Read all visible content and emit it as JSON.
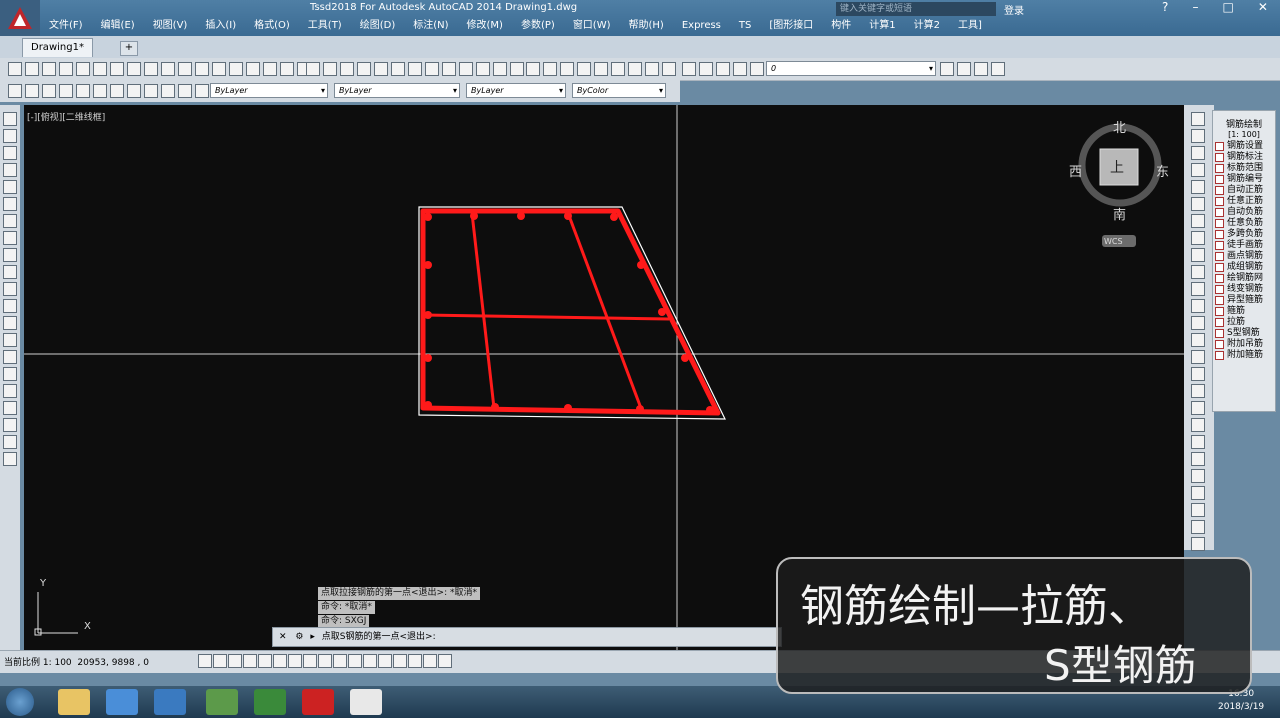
{
  "window": {
    "title": "Tssd2018 For Autodesk AutoCAD 2014    Drawing1.dwg",
    "search_placeholder": "键入关键字或短语",
    "login_label": "登录",
    "controls": [
      "–",
      "□",
      "✕"
    ]
  },
  "menu": [
    "文件(F)",
    "编辑(E)",
    "视图(V)",
    "插入(I)",
    "格式(O)",
    "工具(T)",
    "绘图(D)",
    "标注(N)",
    "修改(M)",
    "参数(P)",
    "窗口(W)",
    "帮助(H)",
    "Express",
    "TS",
    "[图形接口",
    "构件",
    "计算1",
    "计算2",
    "工具]"
  ],
  "tabs": {
    "active": "Drawing1*",
    "add": "+"
  },
  "toolbar": {
    "layer_value": "0",
    "color_dropdown": "ByLayer",
    "linetype_dropdown": "ByLayer",
    "lineweight_dropdown": "ByLayer",
    "plotstyle_dropdown": "ByColor"
  },
  "viewport": {
    "label": "[-][俯视][二维线框]",
    "compass": {
      "north": "北",
      "south": "南",
      "east": "东",
      "west": "西",
      "center": "上",
      "wcs": "WCS"
    },
    "ucs": {
      "x": "X",
      "y": "Y"
    }
  },
  "rebar_panel": {
    "title": "钢筋绘制",
    "subtitle": "[1: 100]",
    "items": [
      "钢筋设置",
      "钢筋标注",
      "标筋范围",
      "钢筋编号",
      "自动正筋",
      "任意正筋",
      "自动负筋",
      "任意负筋",
      "多跨负筋",
      "徒手画筋",
      "画点钢筋",
      "成组钢筋",
      "绘钢筋网",
      "线变钢筋",
      "异型箍筋",
      "箍筋",
      "拉筋",
      "S型钢筋",
      "附加吊筋",
      "附加箍筋"
    ]
  },
  "command": {
    "history": [
      "点取拉接钢筋的第一点<退出>: *取消*",
      "命令: *取消*",
      "命令: SXGJ"
    ],
    "prompt": "点取S钢筋的第一点<退出>:"
  },
  "status": {
    "scale": "当前比例 1: 100",
    "coords": "20953, 9898 , 0"
  },
  "taskbar": {
    "time": "16:30",
    "date": "2018/3/19"
  },
  "caption": {
    "line1": "钢筋绘制—拉筋、",
    "line2": "S型钢筋"
  },
  "colors": {
    "rebar": "#ff1a1a",
    "canvas": "#0d0d0d",
    "outline": "#ffffff"
  }
}
